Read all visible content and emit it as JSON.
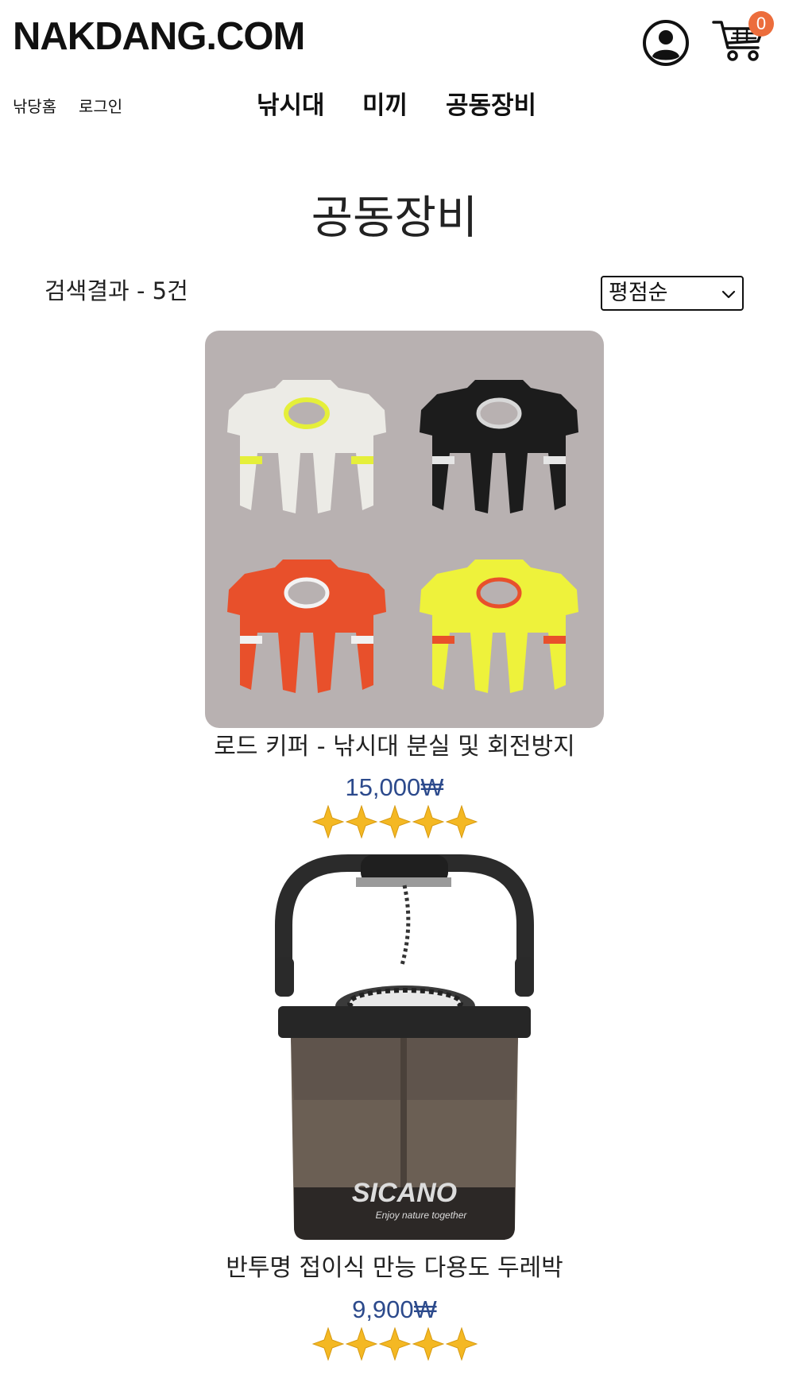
{
  "header": {
    "logo": "NAKDANG.COM",
    "cart_count": "0"
  },
  "nav": {
    "util_links": [
      "낚당홈",
      "로그인"
    ],
    "main_links": [
      "낚시대",
      "미끼",
      "공동장비"
    ]
  },
  "page": {
    "title": "공동장비",
    "result_count": "검색결과 - 5건",
    "sort_value": "평점순"
  },
  "products": [
    {
      "name": "로드 키퍼 - 낚시대 분실 및 회전방지",
      "price": "15,000₩",
      "rating": 5,
      "rating_max": 5
    },
    {
      "name": "반투명 접이식 만능 다용도 두레박",
      "price": "9,900₩",
      "rating": 5,
      "rating_max": 5,
      "image_brand": "SICANO",
      "image_tagline": "Enjoy nature together"
    }
  ],
  "colors": {
    "price": "#2c4a8c",
    "badge": "#ec6d3c",
    "star": "#f4b823",
    "image_bg": "#b8b1b1"
  }
}
